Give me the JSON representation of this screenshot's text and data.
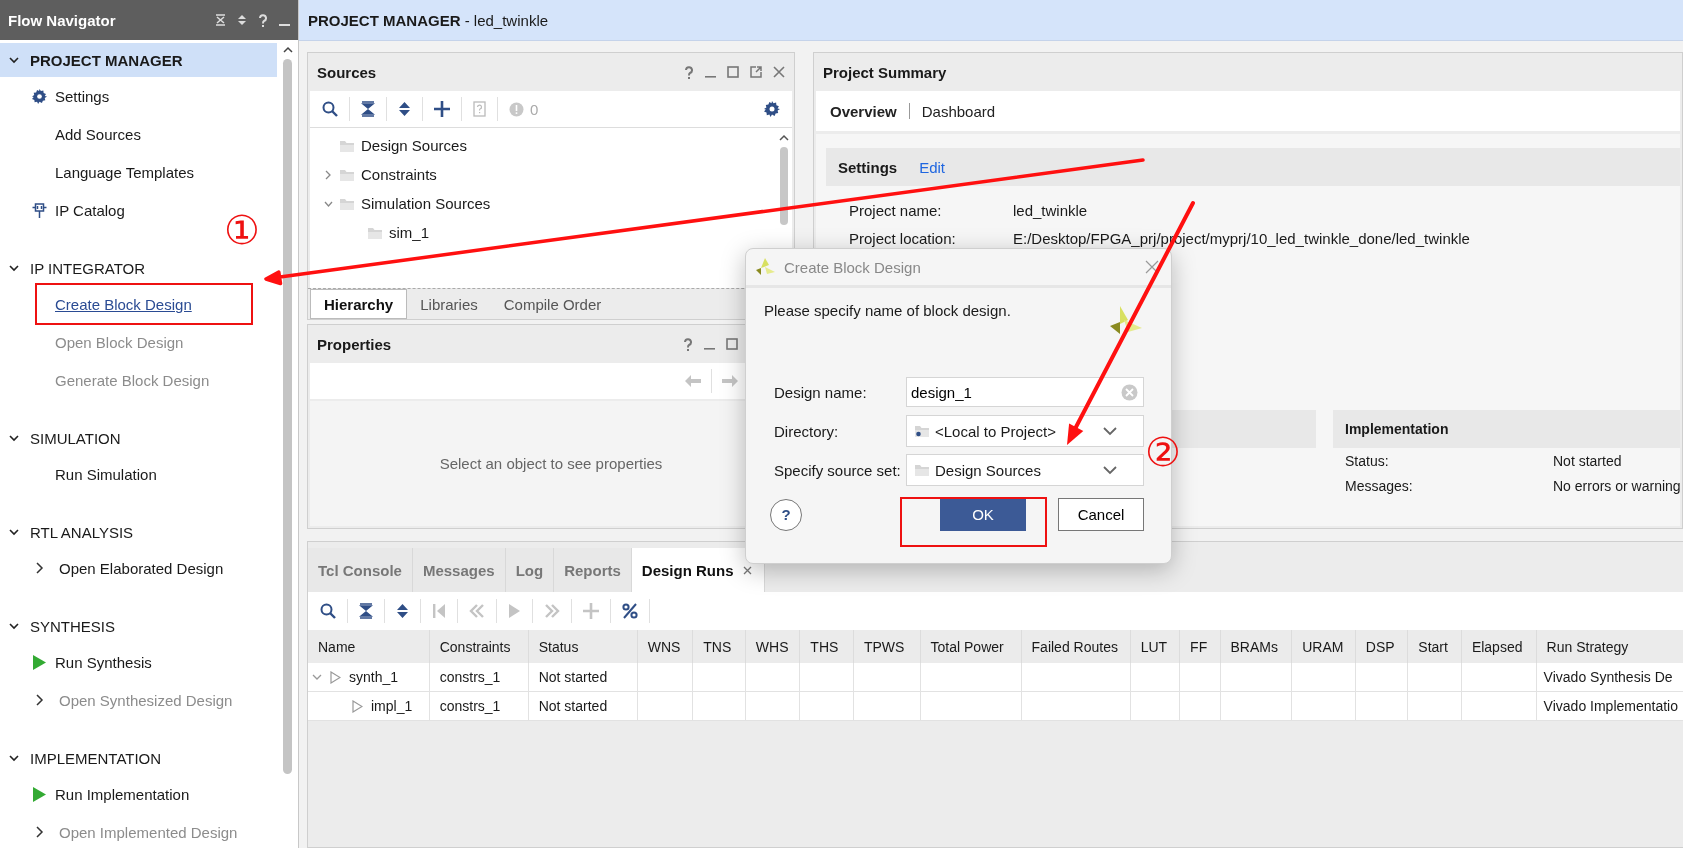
{
  "flow_navigator": {
    "title": "Flow Navigator",
    "sections": [
      {
        "label": "PROJECT MANAGER",
        "expanded": true,
        "selected": true,
        "items": [
          {
            "label": "Settings",
            "kind": "gear",
            "disabled": false,
            "hovered": false
          },
          {
            "label": "Add Sources",
            "kind": "plain",
            "disabled": false,
            "hovered": false
          },
          {
            "label": "Language Templates",
            "kind": "plain",
            "disabled": false,
            "hovered": false
          },
          {
            "label": "IP Catalog",
            "kind": "chip",
            "disabled": false,
            "hovered": false
          }
        ]
      },
      {
        "label": "IP INTEGRATOR",
        "expanded": true,
        "selected": false,
        "items": [
          {
            "label": "Create Block Design",
            "kind": "plain",
            "disabled": false,
            "hovered": true
          },
          {
            "label": "Open Block Design",
            "kind": "plain",
            "disabled": true,
            "hovered": false
          },
          {
            "label": "Generate Block Design",
            "kind": "plain",
            "disabled": true,
            "hovered": false
          }
        ]
      },
      {
        "label": "SIMULATION",
        "expanded": true,
        "selected": false,
        "items": [
          {
            "label": "Run Simulation",
            "kind": "plain",
            "disabled": false,
            "hovered": false
          }
        ]
      },
      {
        "label": "RTL ANALYSIS",
        "expanded": true,
        "selected": false,
        "items": [
          {
            "label": "Open Elaborated Design",
            "kind": "expander",
            "disabled": false,
            "hovered": false
          }
        ]
      },
      {
        "label": "SYNTHESIS",
        "expanded": true,
        "selected": false,
        "items": [
          {
            "label": "Run Synthesis",
            "kind": "run",
            "disabled": false,
            "hovered": false
          },
          {
            "label": "Open Synthesized Design",
            "kind": "expander",
            "disabled": true,
            "hovered": false
          }
        ]
      },
      {
        "label": "IMPLEMENTATION",
        "expanded": true,
        "selected": false,
        "items": [
          {
            "label": "Run Implementation",
            "kind": "run",
            "disabled": false,
            "hovered": false
          },
          {
            "label": "Open Implemented Design",
            "kind": "expander",
            "disabled": true,
            "hovered": false
          }
        ]
      }
    ]
  },
  "header": {
    "title": "**PROJECT MANAGER** - led_twinkle"
  },
  "sources": {
    "title": "Sources",
    "badge": "0",
    "tree": [
      {
        "label": "Design Sources"
      },
      {
        "label": "Constraints",
        "expanded": false
      },
      {
        "label": "Simulation Sources",
        "expanded": true,
        "children": [
          {
            "label": "sim_1"
          }
        ]
      }
    ],
    "tabs": [
      {
        "label": "Hierarchy",
        "selected": true
      },
      {
        "label": "Libraries",
        "selected": false
      },
      {
        "label": "Compile Order",
        "selected": false
      }
    ]
  },
  "properties": {
    "title": "Properties",
    "message": "Select an object to see properties"
  },
  "project_summary": {
    "title": "Project Summary",
    "tabs": [
      {
        "label": "Overview",
        "selected": true
      },
      {
        "label": "Dashboard",
        "selected": false
      }
    ],
    "settings": {
      "title": "Settings",
      "link": "Edit",
      "fields": [
        {
          "label": "Project name:",
          "value": "led_twinkle"
        },
        {
          "label": "Project location:",
          "value": "E:/Desktop/FPGA_prj/project/myprj/10_led_twinkle_done/led_twinkle"
        }
      ]
    },
    "implementation": {
      "title": "Implementation",
      "fields": [
        {
          "label": "Status:",
          "value": "Not started"
        },
        {
          "label": "Messages:",
          "value": "No errors or warning"
        }
      ]
    }
  },
  "dialog": {
    "title": "Create Block Design",
    "message": "Please specify name of block design.",
    "fields": [
      {
        "label": "Design name:",
        "value": "design_1",
        "kind": "text"
      },
      {
        "label": "Directory:",
        "value": "<Local to Project>",
        "kind": "select"
      },
      {
        "label": "Specify source set:",
        "value": "Design Sources",
        "kind": "select"
      }
    ],
    "help": "?",
    "buttons": [
      {
        "label": "OK",
        "primary": true
      },
      {
        "label": "Cancel",
        "primary": false
      }
    ]
  },
  "bottom_panel": {
    "tabs": [
      {
        "label": "Tcl Console",
        "selected": false
      },
      {
        "label": "Messages",
        "selected": false
      },
      {
        "label": "Log",
        "selected": false
      },
      {
        "label": "Reports",
        "selected": false
      },
      {
        "label": "Design Runs",
        "selected": true
      }
    ],
    "table": {
      "columns": [
        "Name",
        "Constraints",
        "Status",
        "WNS",
        "TNS",
        "WHS",
        "THS",
        "TPWS",
        "Total Power",
        "Failed Routes",
        "LUT",
        "FF",
        "BRAMs",
        "URAM",
        "DSP",
        "Start",
        "Elapsed",
        "Run Strategy"
      ],
      "rows": [
        {
          "name": "synth_1",
          "constraints": "constrs_1",
          "status": "Not started",
          "run_strategy": "Vivado Synthesis De",
          "expanded": true,
          "children": [
            {
              "name": "impl_1",
              "constraints": "constrs_1",
              "status": "Not started",
              "run_strategy": "Vivado Implementatio"
            }
          ]
        }
      ]
    }
  },
  "annotations": [
    {
      "text": "①"
    },
    {
      "text": "②"
    }
  ]
}
